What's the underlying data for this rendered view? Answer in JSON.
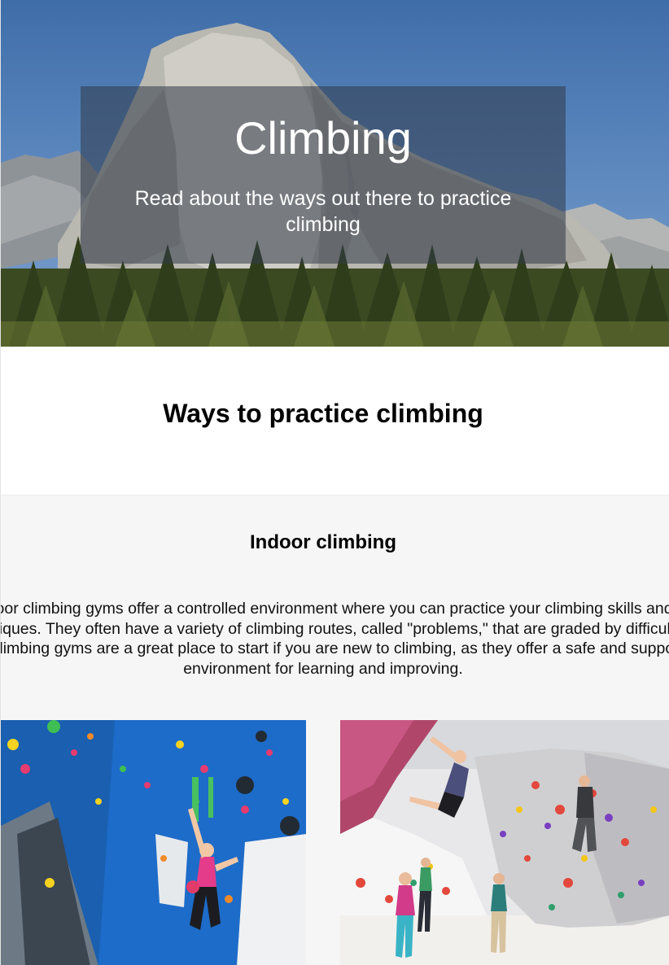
{
  "hero": {
    "title": "Climbing",
    "subtitle": "Read about the ways out there to practice climbing"
  },
  "section": {
    "title": "Ways to practice climbing"
  },
  "indoor": {
    "title": "Indoor climbing",
    "text": "Indoor climbing gyms offer a controlled environment where you can practice your climbing skills and techniques. They often have a variety of climbing routes, called \"problems,\" that are graded by difficulty. Indoor climbing gyms are a great place to start if you are new to climbing, as they offer a safe and supportive environment for learning and improving.",
    "images": [
      {
        "name": "climbing-wall-photo"
      },
      {
        "name": "bouldering-gym-photo"
      }
    ]
  }
}
